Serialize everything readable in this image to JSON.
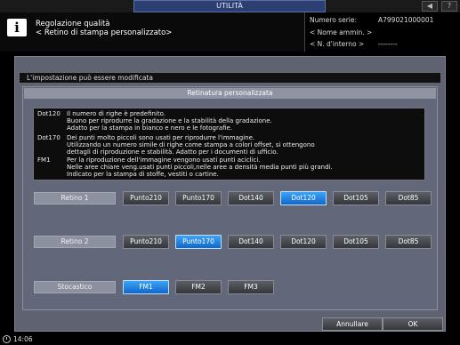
{
  "topbar": {
    "tab": "UTILITÀ",
    "icons": [
      "volume-icon",
      "help-icon"
    ],
    "help_glyph": "?"
  },
  "header": {
    "title_line1": "Regolazione qualità",
    "title_line2": "< Retino di stampa personalizzato>",
    "serial_label": "Numero serie:",
    "serial_value": "A799021000001",
    "admin_label": "< Nome ammin. >",
    "internal_label": "< N. d'interno >",
    "internal_value": "--------"
  },
  "notice": "L'impostazione può essere modificata",
  "panel_title": "Retinatura personalizzata",
  "description": [
    {
      "code": "Dot120",
      "text": "Il numero di righe è predefinito."
    },
    {
      "code": "",
      "text": "Buono per riprodurre la gradazione e la stabilità della gradazione."
    },
    {
      "code": "",
      "text": "Adatto per la stampa in bianco e nero e le fotografie."
    },
    {
      "code": "Dot170",
      "text": "Dei punti molto piccoli sono usati per riprodurre l'immagine."
    },
    {
      "code": "",
      "text": "Utilizzando un numero simile di righe come stampa a colori offset, si ottengono"
    },
    {
      "code": "",
      "text": "dettagli di riproduzione e stabilità. Adatto per i documenti di ufficio."
    },
    {
      "code": "FM1",
      "text": "Per la riproduzione dell'immagine vengono usati punti aciclici."
    },
    {
      "code": "",
      "text": "Nelle aree chiare veng.usati punti piccoli,nelle aree a densità media punti più grandi."
    },
    {
      "code": "",
      "text": "Indicato per la stampa di stoffe, vestiti o cartine."
    }
  ],
  "rows": {
    "retino1": {
      "label": "Retino 1",
      "options": [
        "Punto210",
        "Punto170",
        "Dot140",
        "Dot120",
        "Dot105",
        "Dot85"
      ],
      "selected": 3
    },
    "retino2": {
      "label": "Retino 2",
      "options": [
        "Punto210",
        "Punto170",
        "Dot140",
        "Dot120",
        "Dot105",
        "Dot85"
      ],
      "selected": 1
    },
    "stocastico": {
      "label": "Stocastico",
      "options": [
        "FM1",
        "FM2",
        "FM3"
      ],
      "selected": 0
    }
  },
  "actions": {
    "cancel": "Annullare",
    "ok": "OK"
  },
  "status": {
    "time": "14:06"
  },
  "colors": {
    "selected": "#1f86e3",
    "accent_tab": "#2c3f73"
  }
}
